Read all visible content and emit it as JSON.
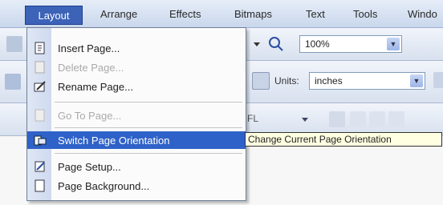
{
  "menubar": {
    "items": [
      {
        "label": "Layout"
      },
      {
        "label": "Arrange"
      },
      {
        "label": "Effects"
      },
      {
        "label": "Bitmaps"
      },
      {
        "label": "Text"
      },
      {
        "label": "Tools"
      },
      {
        "label": "Windo"
      }
    ],
    "active_index": 0
  },
  "toolbar": {
    "zoom_value": "100%",
    "units_label": "Units:",
    "units_value": "inches",
    "size_fragment": "FL"
  },
  "layout_menu": {
    "items": [
      {
        "label": "Insert Page...",
        "icon": "insert-page-icon",
        "enabled": true
      },
      {
        "label": "Delete Page...",
        "icon": "delete-page-icon",
        "enabled": false
      },
      {
        "label": "Rename Page...",
        "icon": "rename-page-icon",
        "enabled": true
      },
      {
        "label": "Go To Page...",
        "icon": "go-to-page-icon",
        "enabled": false
      },
      {
        "label": "Switch Page Orientation",
        "icon": "switch-orientation-icon",
        "enabled": true,
        "highlighted": true
      },
      {
        "label": "Page Setup...",
        "icon": "page-setup-icon",
        "enabled": true
      },
      {
        "label": "Page Background...",
        "icon": "page-background-icon",
        "enabled": true
      }
    ]
  },
  "tooltip": {
    "text": "Change Current Page Orientation"
  },
  "colors": {
    "menu_highlight": "#2f62c8",
    "menubar_active": "#3c63b8",
    "tooltip_bg": "#ffffe1"
  }
}
